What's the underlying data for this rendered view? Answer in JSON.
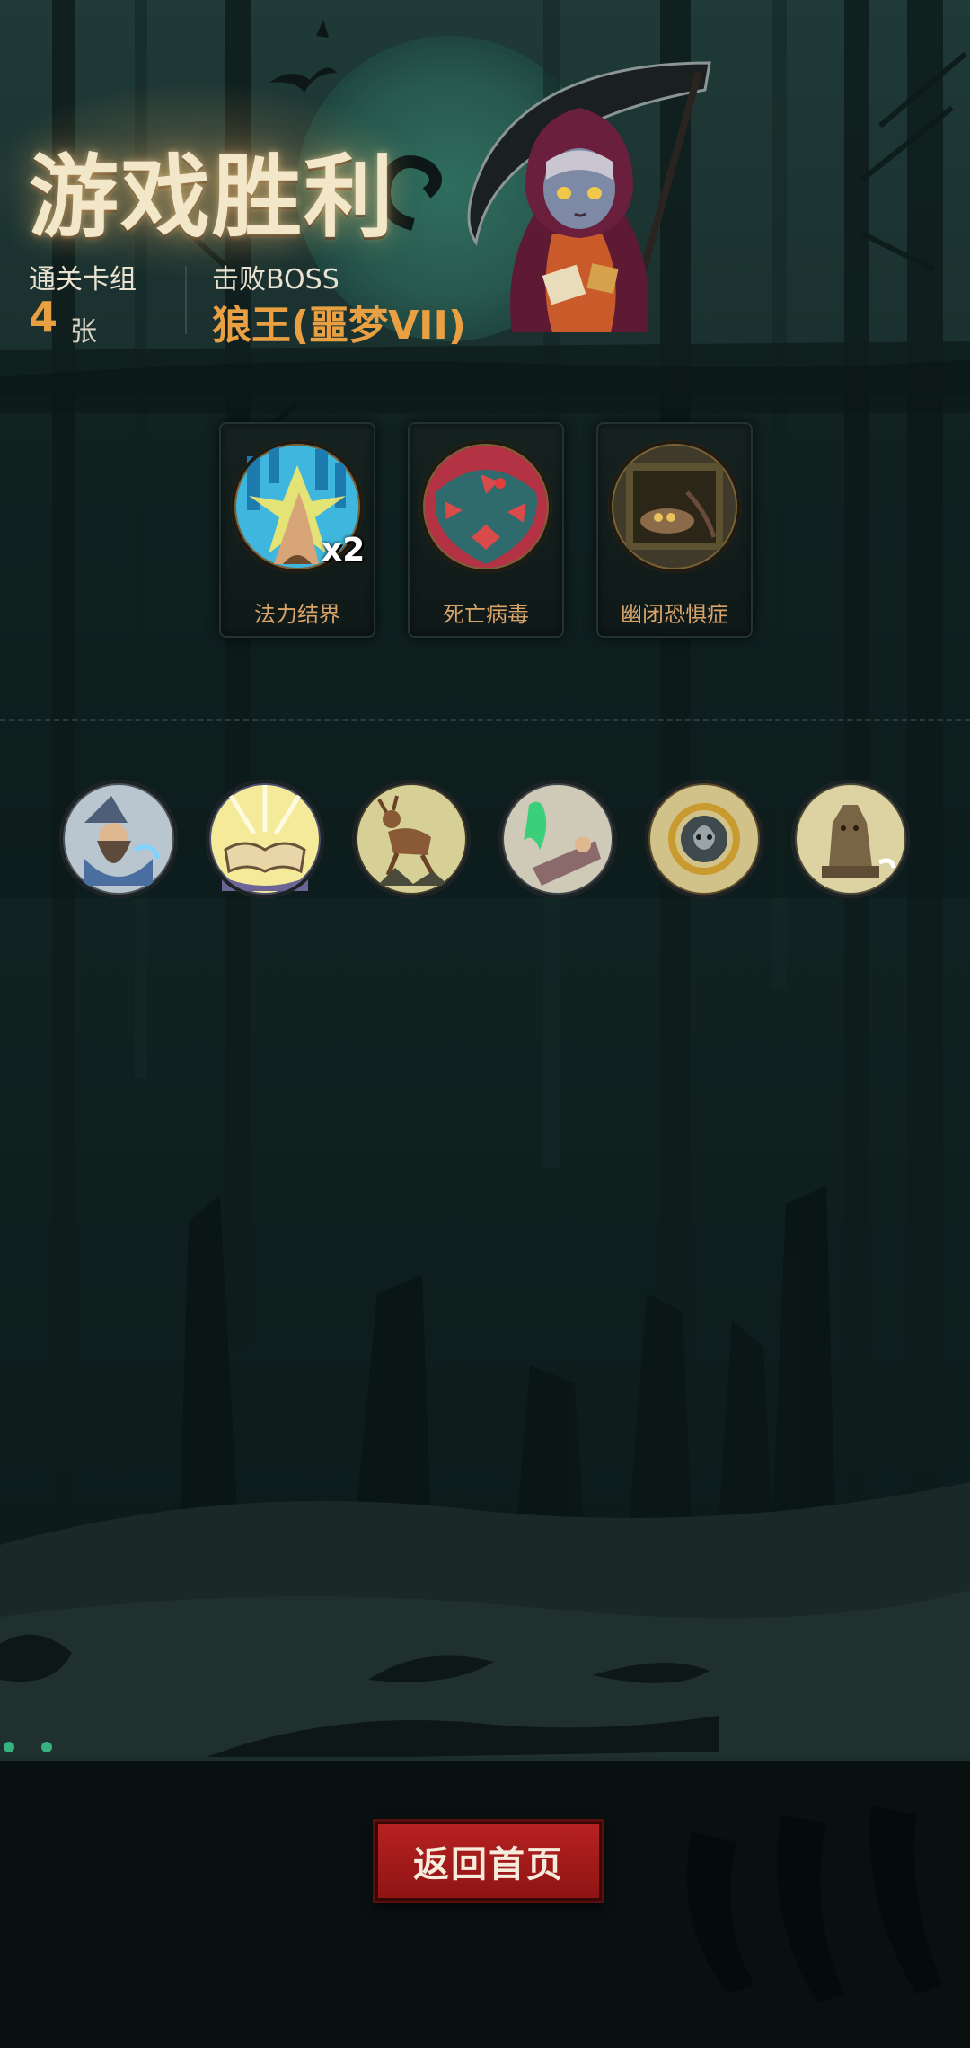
{
  "header": {
    "title": "游戏胜利",
    "deck_label": "通关卡组",
    "deck_count": "4",
    "deck_unit": "张",
    "boss_label": "击败BOSS",
    "boss_name": "狼王(噩梦VII)"
  },
  "rewards": [
    {
      "name": "法力结界",
      "multiplier": "x2",
      "icon": "mana-barrier-hand-icon"
    },
    {
      "name": "死亡病毒",
      "multiplier": "",
      "icon": "death-virus-monster-icon"
    },
    {
      "name": "幽闭恐惧症",
      "multiplier": "",
      "icon": "claustrophobia-coffin-icon"
    }
  ],
  "relics": [
    {
      "icon": "wizard-icon"
    },
    {
      "icon": "glowing-book-icon"
    },
    {
      "icon": "deer-icon"
    },
    {
      "icon": "ghost-bed-icon"
    },
    {
      "icon": "skull-emblem-icon"
    },
    {
      "icon": "stone-statue-icon"
    }
  ],
  "footer": {
    "home_button": "返回首页"
  },
  "colors": {
    "accent_gold": "#e8a042",
    "card_name": "#d8a46a",
    "button_red": "#b72121",
    "background": "#0a1414"
  }
}
